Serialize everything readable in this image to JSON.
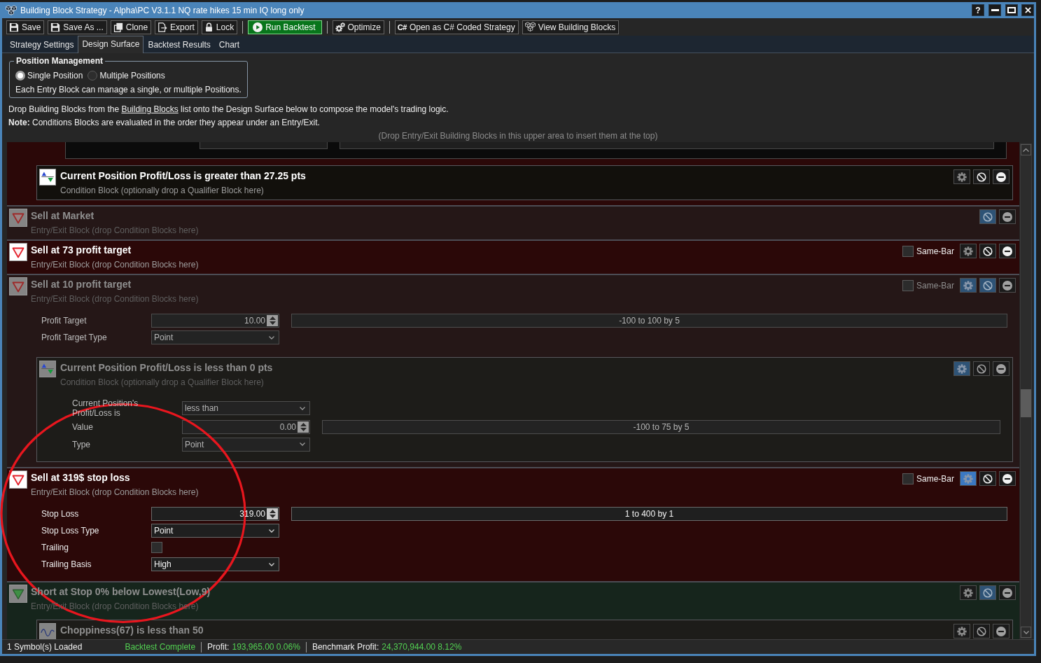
{
  "window": {
    "title": "Building Block Strategy - Alpha\\PC V3.1.1 NQ rate hikes 15 min IQ long only",
    "help_button": "?"
  },
  "toolbar": {
    "groups": [
      [
        {
          "label": "Save",
          "kind": "plain"
        },
        {
          "label": "Save As ...",
          "kind": "plain"
        },
        {
          "label": "Clone",
          "kind": "plain"
        },
        {
          "label": "Export",
          "kind": "plain"
        },
        {
          "label": "Lock",
          "kind": "plain"
        }
      ],
      [
        {
          "label": "Run Backtest",
          "kind": "primary"
        }
      ],
      [
        {
          "label": "Optimize",
          "kind": "plain"
        }
      ],
      [
        {
          "label": "Open as C# Coded Strategy",
          "kind": "plain",
          "glyph": "C#"
        },
        {
          "label": "View Building Blocks",
          "kind": "plain"
        }
      ]
    ]
  },
  "tabs": [
    {
      "label": "Strategy Settings",
      "selected": false
    },
    {
      "label": "Design Surface",
      "selected": true
    },
    {
      "label": "Backtest Results",
      "selected": false
    },
    {
      "label": "Chart",
      "selected": false
    }
  ],
  "position_management": {
    "title": "Position Management",
    "options": [
      {
        "label": "Single Position",
        "selected": true
      },
      {
        "label": "Multiple Positions",
        "selected": false
      }
    ],
    "description": "Each Entry Block can manage a single, or multiple Positions."
  },
  "instructions": {
    "before": "Drop Building Blocks from the ",
    "link": "Building Blocks",
    "after": " list onto the Design Surface below to compose the model's trading logic.",
    "note": "**Note:** Conditions Blocks are evaluated in the order they appear under an Entry/Exit.",
    "drop_hint": "(Drop Entry/Exit Building Blocks in this upper area to insert them at the top)"
  },
  "design_surface": {
    "blocks": [
      {
        "kind": "sell",
        "disabled": false,
        "children": [
          {
            "kind": "clipped"
          },
          {
            "kind": "condition",
            "title": "Current Position Profit/Loss is greater than 27.25 pts",
            "subtitle": "Condition Block (optionally drop a Qualifier Block here)",
            "disabled": false,
            "expanded": false
          }
        ]
      },
      {
        "kind": "sell",
        "title": "Sell at Market",
        "subtitle": "Entry/Exit Block (drop Condition Blocks here)",
        "disabled": true
      },
      {
        "kind": "sell",
        "title": "Sell at 73 profit target",
        "subtitle": "Entry/Exit Block (drop Condition Blocks here)",
        "disabled": false,
        "same_bar": {
          "label": "Same-Bar",
          "checked": false
        },
        "expanded": false
      },
      {
        "kind": "sell",
        "title": "Sell at 10 profit target",
        "subtitle": "Entry/Exit Block (drop Condition Blocks here)",
        "disabled": true,
        "same_bar": {
          "label": "Same-Bar",
          "checked": false
        },
        "expanded": true,
        "params": [
          {
            "kind": "spinner",
            "label": "Profit Target",
            "value": "10.00",
            "range": "-100 to 100 by 5"
          },
          {
            "kind": "dropdown",
            "label": "Profit Target Type",
            "value": "Point"
          }
        ],
        "children": [
          {
            "kind": "condition",
            "title": "Current Position Profit/Loss is less than 0 pts",
            "subtitle": "Condition Block (optionally drop a Qualifier Block here)",
            "disabled": false,
            "expanded": true,
            "params": [
              {
                "kind": "dropdown",
                "label": "Current Position's Profit/Loss is",
                "value": "less than"
              },
              {
                "kind": "spinner",
                "label": "Value",
                "value": "0.00",
                "range": "-100 to 75 by 5"
              },
              {
                "kind": "dropdown",
                "label": "Type",
                "value": "Point"
              }
            ]
          }
        ]
      },
      {
        "kind": "sell",
        "title": "Sell at 319$ stop loss",
        "subtitle": "Entry/Exit Block (drop Condition Blocks here)",
        "disabled": false,
        "same_bar": {
          "label": "Same-Bar",
          "checked": false
        },
        "expanded": true,
        "params": [
          {
            "kind": "spinner",
            "label": "Stop Loss",
            "value": "319.00",
            "range": "1 to 400 by 1"
          },
          {
            "kind": "dropdown",
            "label": "Stop Loss Type",
            "value": "Point"
          },
          {
            "kind": "checkbox",
            "label": "Trailing",
            "checked": false
          },
          {
            "kind": "dropdown",
            "label": "Trailing Basis",
            "value": "High"
          }
        ]
      },
      {
        "kind": "short",
        "title": "Short at Stop 0% below Lowest(Low,9)",
        "subtitle": "Entry/Exit Block (drop Condition Blocks here)",
        "disabled": true,
        "expanded": false,
        "children": [
          {
            "kind": "indicator",
            "title": "Choppiness(67) is less than 50",
            "disabled": false,
            "expanded": false
          }
        ]
      }
    ]
  },
  "status_bar": {
    "message": "1 Symbol(s) Loaded",
    "status": "Backtest Complete",
    "metrics": [
      {
        "label": "Profit:",
        "value": "193,965.00 0.06%"
      },
      {
        "label": "Benchmark Profit:",
        "value": "24,370,944.00 8.12%"
      }
    ]
  },
  "annotation": {
    "kind": "circle"
  }
}
